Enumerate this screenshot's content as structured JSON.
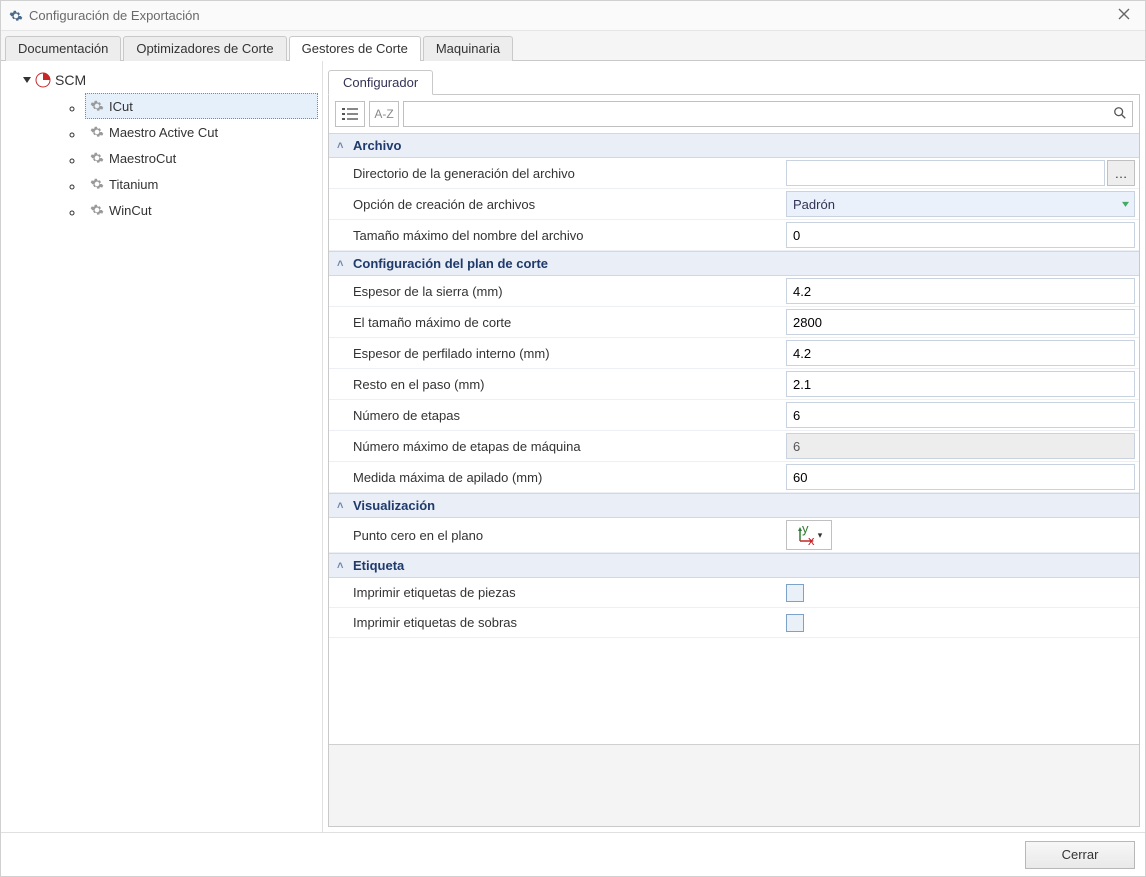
{
  "window": {
    "title": "Configuración de Exportación"
  },
  "tabs": {
    "items": [
      "Documentación",
      "Optimizadores de Corte",
      "Gestores de Corte",
      "Maquinaria"
    ],
    "active_index": 2
  },
  "tree": {
    "root_label": "SCM",
    "items": [
      "ICut",
      "Maestro Active Cut",
      "MaestroCut",
      "Titanium",
      "WinCut"
    ],
    "selected_index": 0
  },
  "sub_tab": {
    "label": "Configurador"
  },
  "toolbar": {
    "az_label": "A-Z",
    "search_placeholder": ""
  },
  "sections": [
    {
      "title": "Archivo",
      "rows": [
        {
          "label": "Directorio de la generación del archivo",
          "type": "file",
          "value": ""
        },
        {
          "label": "Opción de creación de archivos",
          "type": "select",
          "value": "Padrón"
        },
        {
          "label": "Tamaño máximo del nombre del archivo",
          "type": "text",
          "value": "0"
        }
      ]
    },
    {
      "title": "Configuración del plan de corte",
      "rows": [
        {
          "label": "Espesor de la sierra (mm)",
          "type": "text",
          "value": "4.2"
        },
        {
          "label": "El tamaño máximo de corte",
          "type": "text",
          "value": "2800"
        },
        {
          "label": "Espesor de perfilado interno (mm)",
          "type": "text",
          "value": "4.2"
        },
        {
          "label": "Resto en el paso (mm)",
          "type": "text",
          "value": "2.1"
        },
        {
          "label": "Número de etapas",
          "type": "text",
          "value": "6"
        },
        {
          "label": "Número máximo de etapas de máquina",
          "type": "readonly",
          "value": "6"
        },
        {
          "label": "Medida máxima de apilado (mm)",
          "type": "text",
          "value": "60"
        }
      ]
    },
    {
      "title": "Visualización",
      "rows": [
        {
          "label": "Punto cero en el plano",
          "type": "origin",
          "value": ""
        }
      ]
    },
    {
      "title": "Etiqueta",
      "rows": [
        {
          "label": "Imprimir etiquetas de piezas",
          "type": "check",
          "value": false
        },
        {
          "label": "Imprimir etiquetas de sobras",
          "type": "check",
          "value": false
        }
      ]
    }
  ],
  "buttons": {
    "close": "Cerrar"
  }
}
